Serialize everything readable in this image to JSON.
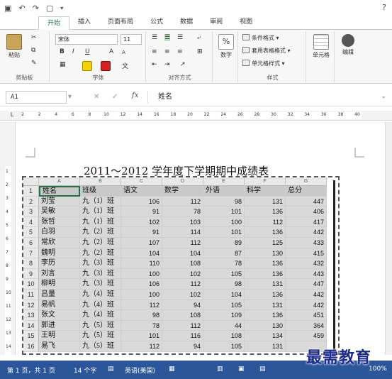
{
  "quick_access": {
    "save_icon": "save-icon",
    "undo_icon": "undo-icon",
    "redo_icon": "redo-icon",
    "new_icon": "new-doc-icon",
    "customize_icon": "customize-qat-icon",
    "help_label": "?"
  },
  "tabs": [
    {
      "label": "开始",
      "active": true
    },
    {
      "label": "插入",
      "active": false
    },
    {
      "label": "页面布局",
      "active": false
    },
    {
      "label": "公式",
      "active": false
    },
    {
      "label": "数据",
      "active": false
    },
    {
      "label": "审阅",
      "active": false
    },
    {
      "label": "视图",
      "active": false
    }
  ],
  "ribbon": {
    "clipboard": {
      "paste_label": "粘贴",
      "group_label": "剪贴板"
    },
    "font": {
      "font_name": "宋体",
      "font_size": "11",
      "bold": "B",
      "italic": "I",
      "underline": "U",
      "grow": "A",
      "shrink": "A",
      "wen": "文",
      "group_label": "字体"
    },
    "alignment": {
      "group_label": "对齐方式"
    },
    "number": {
      "label": "数字",
      "percent": "%"
    },
    "styles": {
      "conditional": "条件格式",
      "table_format": "套用表格格式",
      "cell_styles": "单元格样式",
      "group_label": "样式"
    },
    "cells": {
      "label": "单元格"
    },
    "editing": {
      "label": "编辑"
    }
  },
  "formula_bar": {
    "name_box": "A1",
    "cancel": "✕",
    "enter": "✓",
    "fx": "fx",
    "value": "姓名"
  },
  "ruler": {
    "ticks": [
      "2",
      "2",
      "4",
      "6",
      "8",
      "10",
      "12",
      "14",
      "16",
      "18",
      "20",
      "22",
      "24",
      "26",
      "28",
      "30",
      "32",
      "34",
      "36",
      "38",
      "40"
    ],
    "vertical_ticks": [
      "1",
      "2",
      "3",
      "4",
      "5",
      "6",
      "7",
      "8",
      "9",
      "10",
      "11",
      "12",
      "13",
      "14"
    ]
  },
  "document": {
    "title": "2011～2012 学年度下学期期中成绩表"
  },
  "sheet": {
    "columns": [
      "A",
      "B",
      "C",
      "D",
      "E",
      "F",
      "G"
    ],
    "header_row": [
      "姓名",
      "班级",
      "语文",
      "数学",
      "外语",
      "科学",
      "总分"
    ],
    "rows": [
      [
        "刘莹",
        "九（1）班",
        "106",
        "112",
        "98",
        "131",
        "447"
      ],
      [
        "吴敏",
        "九（1）班",
        "91",
        "78",
        "101",
        "136",
        "406"
      ],
      [
        "张哲",
        "九（1）班",
        "102",
        "103",
        "100",
        "112",
        "417"
      ],
      [
        "白羽",
        "九（2）班",
        "91",
        "114",
        "101",
        "136",
        "442"
      ],
      [
        "常欣",
        "九（2）班",
        "107",
        "112",
        "89",
        "125",
        "433"
      ],
      [
        "魏明",
        "九（2）班",
        "104",
        "104",
        "87",
        "130",
        "415"
      ],
      [
        "李历",
        "九（3）班",
        "110",
        "108",
        "78",
        "136",
        "432"
      ],
      [
        "刘言",
        "九（3）班",
        "100",
        "102",
        "105",
        "136",
        "443"
      ],
      [
        "柳明",
        "九（3）班",
        "106",
        "112",
        "98",
        "131",
        "447"
      ],
      [
        "吕量",
        "九（4）班",
        "100",
        "102",
        "104",
        "136",
        "442"
      ],
      [
        "易帆",
        "九（4）班",
        "112",
        "94",
        "105",
        "131",
        "442"
      ],
      [
        "张文",
        "九（4）班",
        "98",
        "108",
        "109",
        "136",
        "451"
      ],
      [
        "郭进",
        "九（5）班",
        "78",
        "112",
        "44",
        "130",
        "364"
      ],
      [
        "王明",
        "九（5）班",
        "101",
        "116",
        "108",
        "134",
        "459"
      ],
      [
        "易飞",
        "九（5）班",
        "112",
        "94",
        "105",
        "131",
        ""
      ]
    ]
  },
  "status_bar": {
    "page": "第 1 页，共 1 页",
    "words": "14 个字",
    "language": "英语(美国)",
    "zoom": "100%"
  },
  "watermark": "最需教育"
}
